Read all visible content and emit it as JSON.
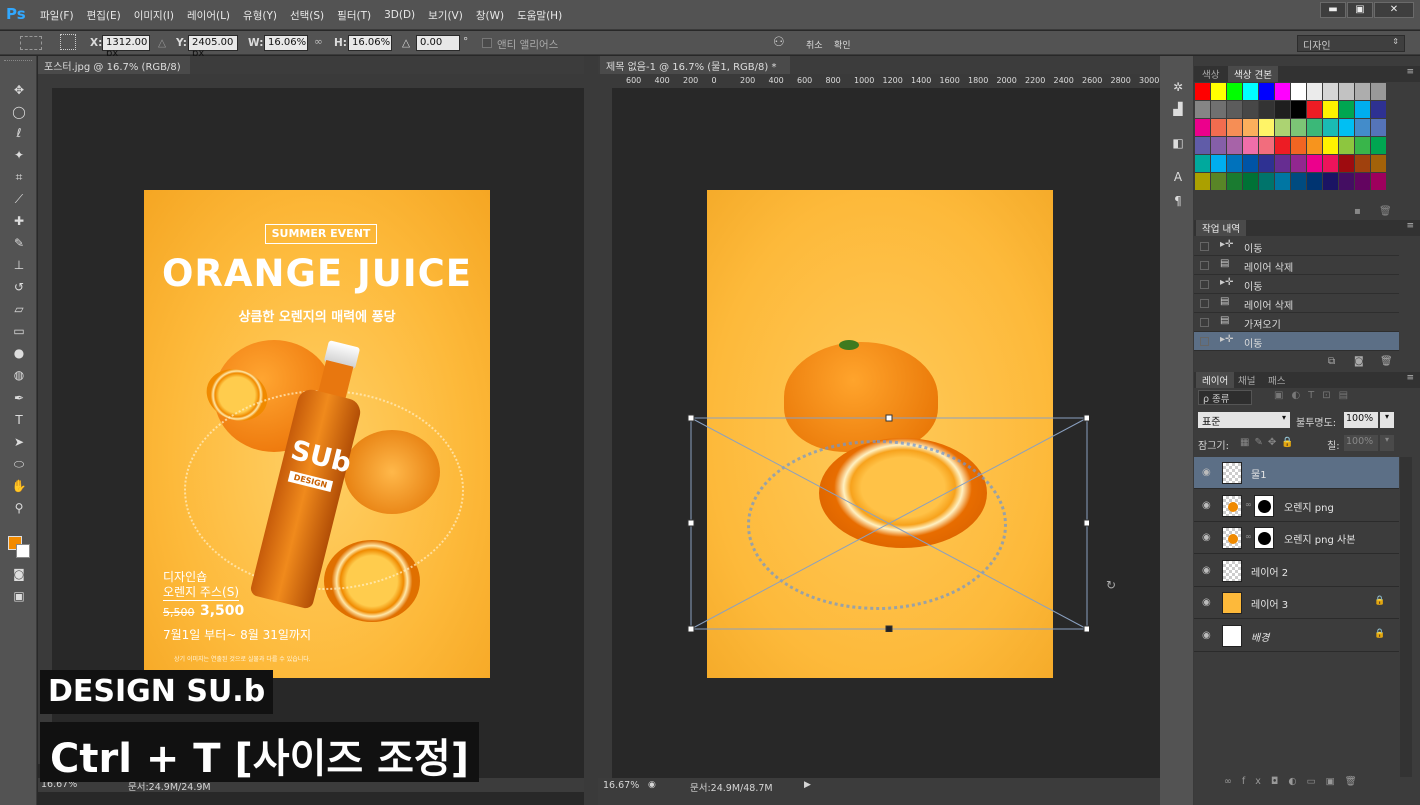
{
  "app": {
    "logo": "Ps"
  },
  "menu": [
    "파일(F)",
    "편집(E)",
    "이미지(I)",
    "레이어(L)",
    "유형(Y)",
    "선택(S)",
    "필터(T)",
    "3D(D)",
    "보기(V)",
    "창(W)",
    "도움말(H)"
  ],
  "window_controls": {
    "minimize": "▬",
    "maximize": "▣",
    "close": "✕"
  },
  "options": {
    "x_label": "X:",
    "x_value": "1312.00 px",
    "y_label": "Y:",
    "y_value": "2405.00 px",
    "w_label": "W:",
    "w_value": "16.06%",
    "h_label": "H:",
    "h_value": "16.06%",
    "angle_label": "△",
    "angle_value": "0.00",
    "angle_unit": "°",
    "antialias": "앤티 앨리어스",
    "cancel": "취소",
    "commit": "확인",
    "workspace": "디자인"
  },
  "documents": [
    {
      "tab": "포스터.jpg @ 16.7% (RGB/8)",
      "close": "×",
      "zoom": "16.67%",
      "doc_size": "문서:24.9M/24.9M"
    },
    {
      "tab": "제목 없음-1 @ 16.7% (물1, RGB/8) *",
      "close": "×",
      "zoom": "16.67%",
      "doc_size": "문서:24.9M/48.7M"
    }
  ],
  "ruler_ticks": [
    "600",
    "400",
    "200",
    "0",
    "200",
    "400",
    "600",
    "800",
    "1000",
    "1200",
    "1400",
    "1600",
    "1800",
    "2000",
    "2200",
    "2400",
    "2600",
    "2800",
    "3000"
  ],
  "poster": {
    "event": "SUMMER EVENT",
    "title": "ORANGE JUICE",
    "subtitle": "상큼한 오렌지의 매력에 퐁당",
    "bottle_brand": "SUb",
    "bottle_sub": "DESIGN",
    "product_line1": "디자인숍",
    "product_line2": "오렌지 주스(S)",
    "old_price": "5,500",
    "new_price": "3,500",
    "period": "7월1일 부터~ 8월 31일까지",
    "fineprint": "상기 이미지는 연출된 것으로 실물과 다를 수 있습니다."
  },
  "overlay": {
    "brand": "DESIGN SU.b",
    "caption": "Ctrl + T [사이즈 조정]"
  },
  "swatch_panel": {
    "tabs": [
      "색상",
      "색상 견본"
    ]
  },
  "swatches": [
    "#ff0000",
    "#ffff00",
    "#00ff00",
    "#00ffff",
    "#0000ff",
    "#ff00ff",
    "#ffffff",
    "#ebebeb",
    "#d6d6d6",
    "#c2c2c2",
    "#adadad",
    "#999999",
    "#858585",
    "#707070",
    "#5c5c5c",
    "#474747",
    "#333333",
    "#1f1f1f",
    "#000000",
    "#ed1c24",
    "#fff200",
    "#00a651",
    "#00aeef",
    "#2e3192",
    "#ec008c",
    "#f26c4f",
    "#f68e55",
    "#fbaf5c",
    "#fff467",
    "#acd372",
    "#7cc576",
    "#3bb878",
    "#1abbb4",
    "#00bff3",
    "#438cca",
    "#5574b9",
    "#605ca8",
    "#855fa8",
    "#a763a8",
    "#f06ea9",
    "#f26d7d",
    "#ed1c24",
    "#f26522",
    "#f7941d",
    "#fff200",
    "#8dc63f",
    "#39b54a",
    "#00a651",
    "#00a99d",
    "#00aeef",
    "#0072bc",
    "#0054a6",
    "#2e3192",
    "#662d91",
    "#92278f",
    "#ec008c",
    "#ed145b",
    "#9e0b0f",
    "#a0410d",
    "#a36209",
    "#aba000",
    "#598527",
    "#1a7b30",
    "#007236",
    "#00746b",
    "#0076a3",
    "#004b80",
    "#003471",
    "#1b1464",
    "#440e62",
    "#630460",
    "#9e005d"
  ],
  "history": {
    "tabs": [
      "작업 내역"
    ],
    "items": [
      {
        "label": "이동",
        "icon": "move-icon"
      },
      {
        "label": "레이어 삭제",
        "icon": "layer-icon"
      },
      {
        "label": "이동",
        "icon": "move-icon"
      },
      {
        "label": "레이어 삭제",
        "icon": "layer-icon"
      },
      {
        "label": "가져오기",
        "icon": "layer-icon"
      },
      {
        "label": "이동",
        "icon": "move-icon"
      }
    ]
  },
  "layers_panel": {
    "tabs": [
      "레이어",
      "채널",
      "패스"
    ],
    "filter": "ρ 종류",
    "blend_mode": "표준",
    "opacity_label": "불투명도:",
    "opacity_value": "100%",
    "lock_label": "잠그기:",
    "fill_label": "칠:",
    "fill_value": "100%",
    "layers": [
      {
        "name": "물1",
        "selected": true,
        "thumb": "checker",
        "mask": false,
        "locked": false
      },
      {
        "name": "오렌지 png",
        "selected": false,
        "thumb": "orange",
        "mask": true,
        "locked": false
      },
      {
        "name": "오렌지 png 사본",
        "selected": false,
        "thumb": "orange",
        "mask": true,
        "locked": false
      },
      {
        "name": "레이어 2",
        "selected": false,
        "thumb": "checker",
        "mask": false,
        "locked": false
      },
      {
        "name": "레이어 3",
        "selected": false,
        "thumb": "yellow",
        "mask": false,
        "locked": true
      },
      {
        "name": "배경",
        "selected": false,
        "thumb": "white",
        "mask": false,
        "locked": true
      }
    ]
  },
  "colors": {
    "accent_fg": "#f28b00",
    "bg": "#ffffff",
    "poster_bg": "#fdb93a",
    "selection": "#5c6f86"
  }
}
